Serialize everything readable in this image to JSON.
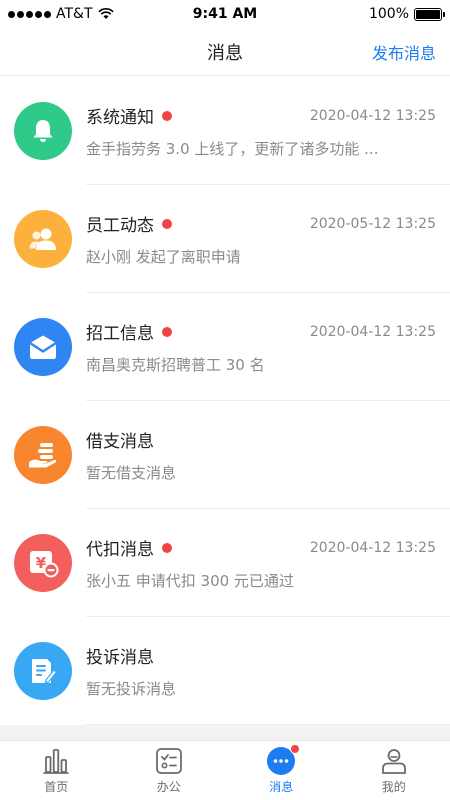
{
  "status_bar": {
    "carrier": "AT&T",
    "time": "9:41 AM",
    "battery": "100%",
    "battery_level": 1.0
  },
  "header": {
    "title": "消息",
    "action": "发布消息"
  },
  "colors": {
    "accent": "#1d7cf2",
    "unread": "#ef4444"
  },
  "messages": [
    {
      "title": "系统通知",
      "unread": true,
      "time": "2020-04-12 13:25",
      "subtitle": "金手指劳务 3.0 上线了，更新了诸多功能 ...",
      "icon": "bell-icon",
      "color": "#2fc98a"
    },
    {
      "title": "员工动态",
      "unread": true,
      "time": "2020-05-12 13:25",
      "subtitle": "赵小刚 发起了离职申请",
      "icon": "users-icon",
      "color": "#fbb13c"
    },
    {
      "title": "招工信息",
      "unread": true,
      "time": "2020-04-12 13:25",
      "subtitle": "南昌奥克斯招聘普工 30 名",
      "icon": "envelope-icon",
      "color": "#2f86f3"
    },
    {
      "title": "借支消息",
      "unread": false,
      "time": "",
      "subtitle": "暂无借支消息",
      "icon": "hand-coins-icon",
      "color": "#f7862e"
    },
    {
      "title": "代扣消息",
      "unread": true,
      "time": "2020-04-12 13:25",
      "subtitle": "张小五 申请代扣 300 元已通过",
      "icon": "yen-minus-icon",
      "color": "#f25f5c"
    },
    {
      "title": "投诉消息",
      "unread": false,
      "time": "",
      "subtitle": "暂无投诉消息",
      "icon": "document-edit-icon",
      "color": "#38a8f5"
    }
  ],
  "tabs": [
    {
      "label": "首页",
      "icon": "bar-chart-icon",
      "active": false
    },
    {
      "label": "办公",
      "icon": "checklist-icon",
      "active": false
    },
    {
      "label": "消息",
      "icon": "chat-bubble-icon",
      "active": true,
      "badge": true
    },
    {
      "label": "我的",
      "icon": "person-icon",
      "active": false
    }
  ]
}
